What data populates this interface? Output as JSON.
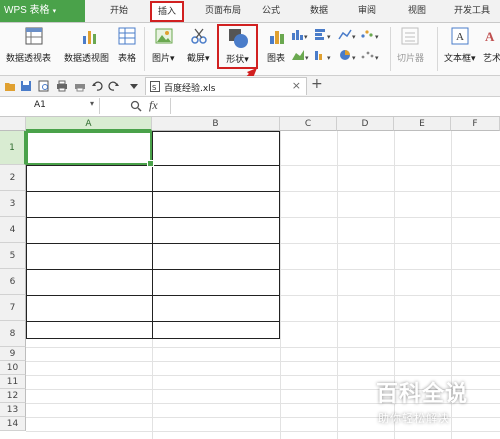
{
  "app": {
    "name": "WPS 表格",
    "dropdown_icon": "caret-down-icon",
    "brand_color": "#4aa24a"
  },
  "tabs": [
    {
      "label": "开始"
    },
    {
      "label": "插入",
      "active": true
    },
    {
      "label": "页面布局"
    },
    {
      "label": "公式"
    },
    {
      "label": "数据"
    },
    {
      "label": "审阅"
    },
    {
      "label": "视图"
    },
    {
      "label": "开发工具"
    }
  ],
  "ribbon": {
    "pivot_table": "数据透视表",
    "pivot_chart": "数据透视图",
    "table": "表格",
    "picture": "图片",
    "screenshot": "截屏",
    "shapes": "形状",
    "chart": "图表",
    "slicer": "切片器",
    "textbox": "文本框",
    "art": "艺术"
  },
  "file_tab": {
    "name": "百度经验.xls",
    "close": "×",
    "new": "+"
  },
  "formula_bar": {
    "cell_ref": "A1",
    "fx": "fx",
    "formula": ""
  },
  "sheet": {
    "columns": [
      "A",
      "B",
      "C",
      "D",
      "E",
      "F"
    ],
    "rows": [
      "1",
      "2",
      "3",
      "4",
      "5",
      "6",
      "7",
      "8",
      "9",
      "10",
      "11",
      "12",
      "13",
      "14"
    ],
    "selected_cell": "A1"
  },
  "annotation_color": "#d12020",
  "watermark": {
    "title": "百科全说",
    "subtitle": "助你轻松解决"
  }
}
